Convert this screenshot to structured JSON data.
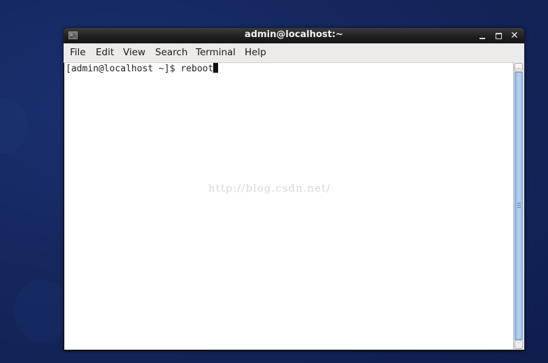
{
  "window": {
    "title": "admin@localhost:~",
    "icon": "terminal-icon",
    "controls": {
      "minimize": "minimize-icon",
      "maximize": "maximize-icon",
      "close": "close-icon",
      "close_glyph": "✕"
    }
  },
  "menu": {
    "items": [
      {
        "label": "File"
      },
      {
        "label": "Edit"
      },
      {
        "label": "View"
      },
      {
        "label": "Search"
      },
      {
        "label": "Terminal"
      },
      {
        "label": "Help"
      }
    ]
  },
  "terminal": {
    "prompt": "[admin@localhost ~]$ ",
    "command": "reboot"
  },
  "watermark": "http://blog.csdn.net/",
  "scrollbar": {
    "up_glyph": "︿",
    "down_glyph": "﹀"
  },
  "colors": {
    "desktop": "#13265c",
    "scroll_thumb": "#a9c6ee"
  }
}
